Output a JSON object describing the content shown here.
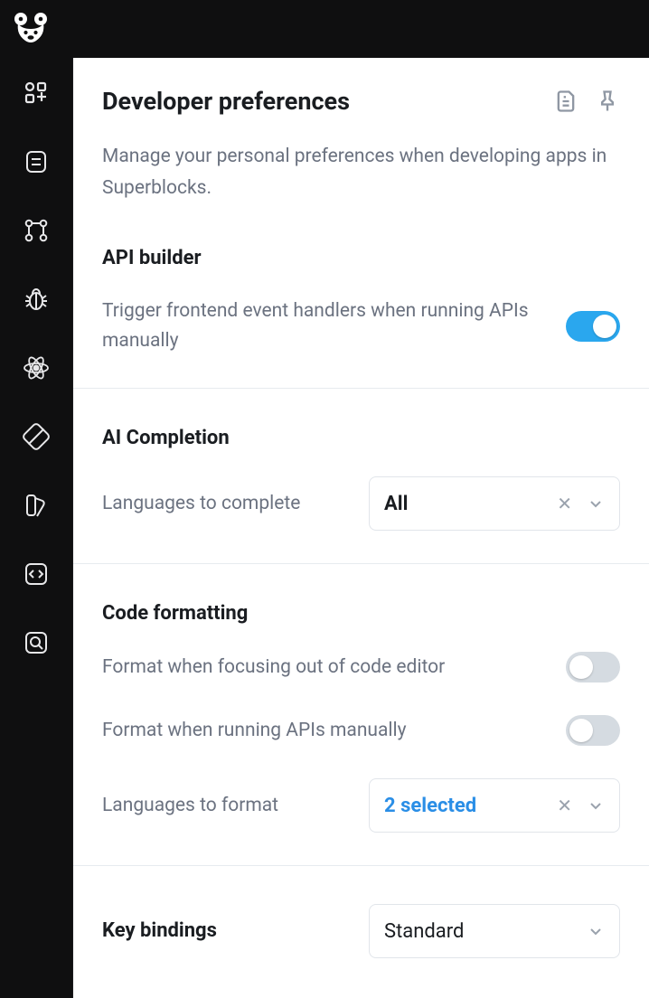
{
  "page": {
    "title": "Developer preferences",
    "subtitle": "Manage your personal preferences when developing apps in Superblocks."
  },
  "api_builder": {
    "heading": "API builder",
    "trigger_label": "Trigger frontend event handlers when running APIs manually",
    "trigger_enabled": true
  },
  "ai_completion": {
    "heading": "AI Completion",
    "lang_label": "Languages to complete",
    "lang_value": "All"
  },
  "code_formatting": {
    "heading": "Code formatting",
    "focus_out_label": "Format when focusing out of code editor",
    "focus_out_enabled": false,
    "run_label": "Format when running APIs manually",
    "run_enabled": false,
    "lang_label": "Languages to format",
    "lang_value": "2 selected"
  },
  "key_bindings": {
    "label": "Key bindings",
    "value": "Standard"
  }
}
